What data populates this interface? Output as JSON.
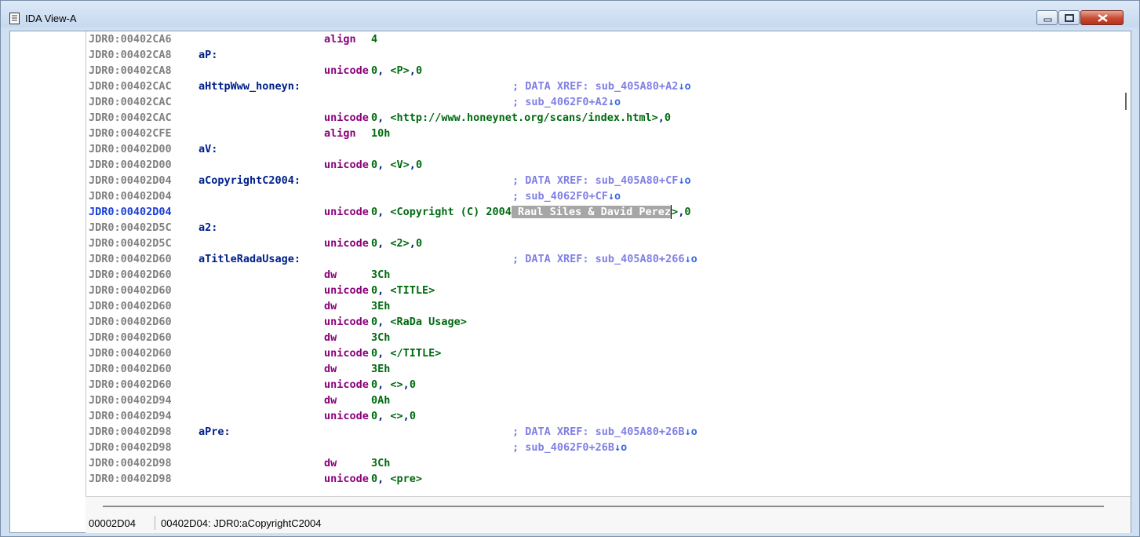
{
  "window": {
    "title": "IDA View-A"
  },
  "listing": [
    {
      "bullet": true,
      "addr": "JDR0:00402CA6",
      "label": "",
      "mnem": "align",
      "ops": [
        [
          "num",
          "4"
        ]
      ],
      "comment": ""
    },
    {
      "bullet": false,
      "addr": "JDR0:00402CA8",
      "label": "aP:",
      "mnem": "",
      "ops": [],
      "comment": ""
    },
    {
      "bullet": true,
      "addr": "JDR0:00402CA8",
      "label": "",
      "mnem": "unicode",
      "ops": [
        [
          "num",
          "0"
        ],
        [
          "dark",
          ", "
        ],
        [
          "str",
          "<P>"
        ],
        [
          "dark",
          ","
        ],
        [
          "num",
          "0"
        ]
      ],
      "comment": ""
    },
    {
      "bullet": false,
      "addr": "JDR0:00402CAC",
      "label": "aHttpWww_honeyn:",
      "mnem": "",
      "ops": [],
      "comment": "; DATA XREF: sub_405A80+A2",
      "arrow": "↓o"
    },
    {
      "bullet": false,
      "addr": "JDR0:00402CAC",
      "label": "",
      "mnem": "",
      "ops": [],
      "comment": "; sub_4062F0+A2",
      "arrow": "↓o"
    },
    {
      "bullet": true,
      "addr": "JDR0:00402CAC",
      "label": "",
      "mnem": "unicode",
      "ops": [
        [
          "num",
          "0"
        ],
        [
          "dark",
          ", "
        ],
        [
          "str",
          "<http://www.honeynet.org/scans/index.html>"
        ],
        [
          "dark",
          ","
        ],
        [
          "num",
          "0"
        ]
      ],
      "comment": ""
    },
    {
      "bullet": true,
      "addr": "JDR0:00402CFE",
      "label": "",
      "mnem": "align",
      "ops": [
        [
          "num",
          "10h"
        ]
      ],
      "comment": ""
    },
    {
      "bullet": false,
      "addr": "JDR0:00402D00",
      "label": "aV:",
      "mnem": "",
      "ops": [],
      "comment": ""
    },
    {
      "bullet": true,
      "addr": "JDR0:00402D00",
      "label": "",
      "mnem": "unicode",
      "ops": [
        [
          "num",
          "0"
        ],
        [
          "dark",
          ", "
        ],
        [
          "str",
          "<V>"
        ],
        [
          "dark",
          ","
        ],
        [
          "num",
          "0"
        ]
      ],
      "comment": ""
    },
    {
      "bullet": false,
      "addr": "JDR0:00402D04",
      "label": "aCopyrightC2004:",
      "mnem": "",
      "ops": [],
      "comment": "; DATA XREF: sub_405A80+CF",
      "arrow": "↓o"
    },
    {
      "bullet": false,
      "addr": "JDR0:00402D04",
      "label": "",
      "mnem": "",
      "ops": [],
      "comment": "; sub_4062F0+CF",
      "arrow": "↓o"
    },
    {
      "bullet": true,
      "addr": "JDR0:00402D04",
      "current": true,
      "label": "",
      "mnem": "unicode",
      "ops": [
        [
          "num",
          "0"
        ],
        [
          "dark",
          ", "
        ],
        [
          "str",
          "<Copyright (C) 2004"
        ],
        [
          "sel",
          " Raul Siles & David Perez"
        ],
        [
          "caret",
          ""
        ],
        [
          "str",
          ">"
        ],
        [
          "dark",
          ","
        ],
        [
          "num",
          "0"
        ]
      ],
      "comment": ""
    },
    {
      "bullet": false,
      "addr": "JDR0:00402D5C",
      "label": "a2:",
      "mnem": "",
      "ops": [],
      "comment": ""
    },
    {
      "bullet": true,
      "addr": "JDR0:00402D5C",
      "label": "",
      "mnem": "unicode",
      "ops": [
        [
          "num",
          "0"
        ],
        [
          "dark",
          ", "
        ],
        [
          "str",
          "<2>"
        ],
        [
          "dark",
          ","
        ],
        [
          "num",
          "0"
        ]
      ],
      "comment": ""
    },
    {
      "bullet": false,
      "addr": "JDR0:00402D60",
      "label": "aTitleRadaUsage:",
      "mnem": "",
      "ops": [],
      "comment": "; DATA XREF: sub_405A80+266",
      "arrow": "↓o"
    },
    {
      "bullet": true,
      "addr": "JDR0:00402D60",
      "label": "",
      "mnem": "dw",
      "ops": [
        [
          "num",
          "3Ch"
        ]
      ],
      "comment": ""
    },
    {
      "bullet": false,
      "addr": "JDR0:00402D60",
      "label": "",
      "mnem": "unicode",
      "ops": [
        [
          "num",
          "0"
        ],
        [
          "dark",
          ", "
        ],
        [
          "str",
          "<TITLE>"
        ]
      ],
      "comment": ""
    },
    {
      "bullet": false,
      "addr": "JDR0:00402D60",
      "label": "",
      "mnem": "dw",
      "ops": [
        [
          "num",
          "3Eh"
        ]
      ],
      "comment": ""
    },
    {
      "bullet": false,
      "addr": "JDR0:00402D60",
      "label": "",
      "mnem": "unicode",
      "ops": [
        [
          "num",
          "0"
        ],
        [
          "dark",
          ", "
        ],
        [
          "str",
          "<RaDa Usage>"
        ]
      ],
      "comment": ""
    },
    {
      "bullet": false,
      "addr": "JDR0:00402D60",
      "label": "",
      "mnem": "dw",
      "ops": [
        [
          "num",
          "3Ch"
        ]
      ],
      "comment": ""
    },
    {
      "bullet": false,
      "addr": "JDR0:00402D60",
      "label": "",
      "mnem": "unicode",
      "ops": [
        [
          "num",
          "0"
        ],
        [
          "dark",
          ", "
        ],
        [
          "str",
          "</TITLE>"
        ]
      ],
      "comment": ""
    },
    {
      "bullet": false,
      "addr": "JDR0:00402D60",
      "label": "",
      "mnem": "dw",
      "ops": [
        [
          "num",
          "3Eh"
        ]
      ],
      "comment": ""
    },
    {
      "bullet": false,
      "addr": "JDR0:00402D60",
      "label": "",
      "mnem": "unicode",
      "ops": [
        [
          "num",
          "0"
        ],
        [
          "dark",
          ", "
        ],
        [
          "str",
          "<>"
        ],
        [
          "dark",
          ","
        ],
        [
          "num",
          "0"
        ]
      ],
      "comment": ""
    },
    {
      "bullet": true,
      "addr": "JDR0:00402D94",
      "label": "",
      "mnem": "dw",
      "ops": [
        [
          "num",
          "0Ah"
        ]
      ],
      "comment": ""
    },
    {
      "bullet": false,
      "addr": "JDR0:00402D94",
      "label": "",
      "mnem": "unicode",
      "ops": [
        [
          "num",
          "0"
        ],
        [
          "dark",
          ", "
        ],
        [
          "str",
          "<>"
        ],
        [
          "dark",
          ","
        ],
        [
          "num",
          "0"
        ]
      ],
      "comment": ""
    },
    {
      "bullet": false,
      "addr": "JDR0:00402D98",
      "label": "aPre:",
      "mnem": "",
      "ops": [],
      "comment": "; DATA XREF: sub_405A80+26B",
      "arrow": "↓o"
    },
    {
      "bullet": false,
      "addr": "JDR0:00402D98",
      "label": "",
      "mnem": "",
      "ops": [],
      "comment": "; sub_4062F0+26B",
      "arrow": "↓o"
    },
    {
      "bullet": true,
      "addr": "JDR0:00402D98",
      "label": "",
      "mnem": "dw",
      "ops": [
        [
          "num",
          "3Ch"
        ]
      ],
      "comment": ""
    },
    {
      "bullet": false,
      "addr": "JDR0:00402D98",
      "label": "",
      "mnem": "unicode",
      "ops": [
        [
          "num",
          "0"
        ],
        [
          "dark",
          ", "
        ],
        [
          "str",
          "<pre>"
        ]
      ],
      "comment": ""
    }
  ],
  "status": {
    "file_offset": "00002D04",
    "location": "00402D04: JDR0:aCopyrightC2004"
  }
}
